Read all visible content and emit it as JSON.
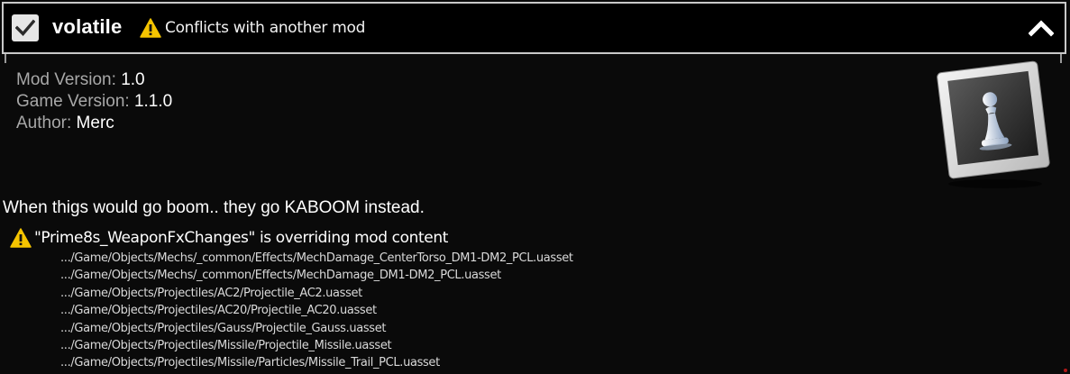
{
  "header": {
    "enabled": true,
    "mod_name": "volatile",
    "conflict_text": "Conflicts with another mod",
    "collapse_icon": "chevron-up-icon",
    "warning_icon": "warning-icon"
  },
  "info": {
    "mod_version_label": "Mod Version:",
    "mod_version_value": "1.0",
    "game_version_label": "Game Version:",
    "game_version_value": "1.1.0",
    "author_label": "Author:",
    "author_value": "Merc"
  },
  "preview_icon": "chess-pawn-photo-icon",
  "description": "When thigs would go boom.. they go KABOOM instead.",
  "override": {
    "title": "\"Prime8s_WeaponFxChanges\" is overriding mod content",
    "files": [
      ".../Game/Objects/Mechs/_common/Effects/MechDamage_CenterTorso_DM1-DM2_PCL.uasset",
      ".../Game/Objects/Mechs/_common/Effects/MechDamage_DM1-DM2_PCL.uasset",
      ".../Game/Objects/Projectiles/AC2/Projectile_AC2.uasset",
      ".../Game/Objects/Projectiles/AC20/Projectile_AC20.uasset",
      ".../Game/Objects/Projectiles/Gauss/Projectile_Gauss.uasset",
      ".../Game/Objects/Projectiles/Missile/Projectile_Missile.uasset",
      ".../Game/Objects/Projectiles/Missile/Particles/Missile_Trail_PCL.uasset"
    ]
  },
  "colors": {
    "background": "#0a0a0a",
    "header_border": "#c9c9c9",
    "label_gray": "#a8a8a8",
    "warning_yellow": "#f5c400"
  }
}
